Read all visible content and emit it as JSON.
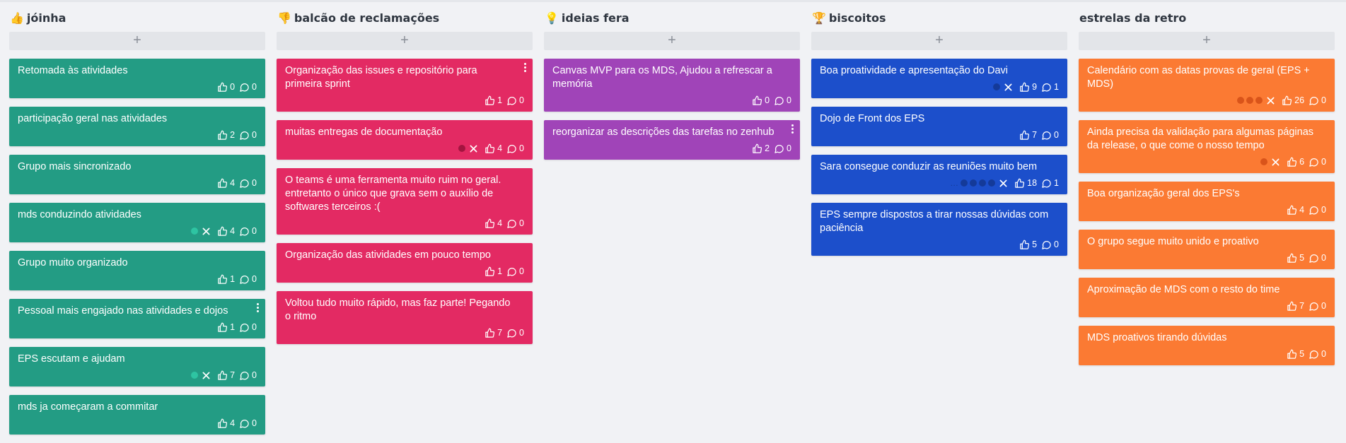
{
  "columns": [
    {
      "emoji": "👍",
      "title": "jóinha",
      "color": "#239c84",
      "dot_color": "#2ec4a2",
      "cards": [
        {
          "text": "Retomada às atividades",
          "likes": "0",
          "comments": "0"
        },
        {
          "text": "participação geral nas atividades",
          "likes": "2",
          "comments": "0"
        },
        {
          "text": "Grupo mais sincronizado",
          "likes": "4",
          "comments": "0"
        },
        {
          "text": "mds conduzindo atividades",
          "likes": "4",
          "comments": "0",
          "dots": 1,
          "removable": true
        },
        {
          "text": "Grupo muito organizado",
          "likes": "1",
          "comments": "0"
        },
        {
          "text": "Pessoal mais engajado nas atividades e dojos",
          "likes": "1",
          "comments": "0",
          "menu": true
        },
        {
          "text": "EPS escutam e ajudam",
          "likes": "7",
          "comments": "0",
          "dots": 1,
          "removable": true
        },
        {
          "text": "mds ja começaram a commitar",
          "likes": "4",
          "comments": "0"
        }
      ]
    },
    {
      "emoji": "👎",
      "title": "balcão de reclamações",
      "color": "#e32a63",
      "dot_color": "#a3143f",
      "cards": [
        {
          "text": "Organização das issues e repositório para primeira sprint",
          "likes": "1",
          "comments": "0",
          "menu": true
        },
        {
          "text": "muitas entregas de documentação",
          "likes": "4",
          "comments": "0",
          "dots": 1,
          "removable": true
        },
        {
          "text": "O teams é uma ferramenta muito ruim no geral. entretanto o único que grava sem o auxílio de softwares terceiros :(",
          "likes": "4",
          "comments": "0"
        },
        {
          "text": "Organização das atividades em pouco tempo",
          "likes": "1",
          "comments": "0"
        },
        {
          "text": "Voltou tudo muito rápido, mas faz parte! Pegando o ritmo",
          "likes": "7",
          "comments": "0"
        }
      ]
    },
    {
      "emoji": "💡",
      "title": "ideias fera",
      "color": "#a044b8",
      "dot_color": "#7a2a90",
      "cards": [
        {
          "text": "Canvas MVP para os MDS, Ajudou a refrescar a memória",
          "likes": "0",
          "comments": "0"
        },
        {
          "text": "reorganizar as descrições das tarefas no zenhub",
          "likes": "2",
          "comments": "0",
          "menu": true
        }
      ]
    },
    {
      "emoji": "🏆",
      "title": "biscoitos",
      "color": "#1c4fcb",
      "dot_color": "#143a99",
      "cards": [
        {
          "text": "Boa proatividade e apresentação do Davi",
          "likes": "9",
          "comments": "1",
          "dots": 1,
          "removable": true
        },
        {
          "text": "Dojo de Front dos EPS",
          "likes": "7",
          "comments": "0"
        },
        {
          "text": "Sara consegue conduzir as reuniões muito bem",
          "likes": "18",
          "comments": "1",
          "dots": 4,
          "ellipsis": true,
          "removable": true
        },
        {
          "text": "EPS sempre dispostos a tirar nossas dúvidas com paciência",
          "likes": "5",
          "comments": "0"
        }
      ]
    },
    {
      "emoji": "",
      "title": "estrelas da retro",
      "color": "#fb7a33",
      "dot_color": "#d9541a",
      "cards": [
        {
          "text": "Calendário com as datas provas de geral (EPS + MDS)",
          "likes": "26",
          "comments": "0",
          "dots": 3,
          "removable": true
        },
        {
          "text": "Ainda precisa da validação para algumas páginas da release, o que come o nosso tempo",
          "likes": "6",
          "comments": "0",
          "dots": 1,
          "removable": true
        },
        {
          "text": "Boa organização geral dos EPS's",
          "likes": "4",
          "comments": "0"
        },
        {
          "text": "O grupo segue muito unido e proativo",
          "likes": "5",
          "comments": "0"
        },
        {
          "text": "Aproximação de MDS com o resto do time",
          "likes": "7",
          "comments": "0"
        },
        {
          "text": "MDS proativos tirando dúvidas",
          "likes": "5",
          "comments": "0"
        }
      ]
    }
  ],
  "add_label": "+",
  "icons": {
    "like": "thumbs-up-icon",
    "comment": "comment-bubble-icon",
    "remove": "close-icon",
    "menu": "kebab-menu-icon"
  }
}
